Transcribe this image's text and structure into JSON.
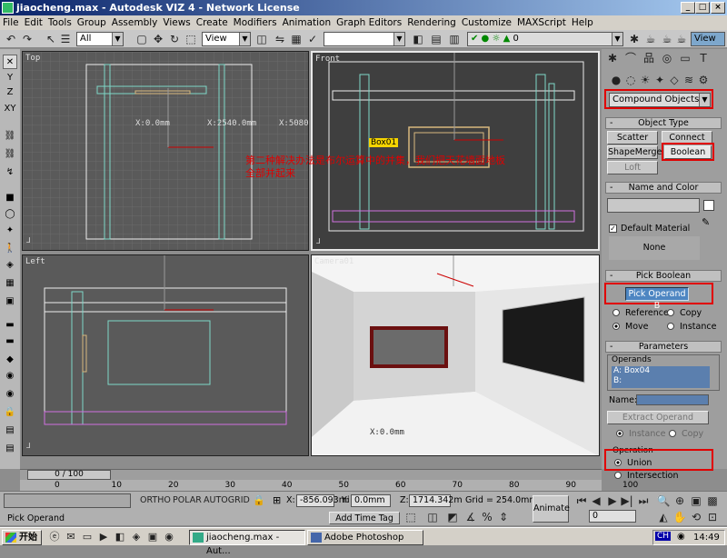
{
  "window": {
    "title": "jiaocheng.max - Autodesk VIZ 4 - Network License"
  },
  "menu": [
    "File",
    "Edit",
    "Tools",
    "Group",
    "Assembly",
    "Views",
    "Create",
    "Modifiers",
    "Animation",
    "Graph Editors",
    "Rendering",
    "Customize",
    "MAXScript",
    "Help"
  ],
  "toolbar": {
    "selection_filter": "All",
    "ref_coord": "View",
    "named_selection": "",
    "layer": "0",
    "view_right": "View"
  },
  "viewports": {
    "top": {
      "label": "Top",
      "coord_x": "X:0.0mm",
      "coord_x2": "X:2540.0mm",
      "coord_x3": "X:5080"
    },
    "front": {
      "label": "Front",
      "object_tag": "Box01",
      "annotation_line1": "第二种解决办法是布尔运算中的并集，我们把天花墙面地板",
      "annotation_line2": "全部并起来"
    },
    "left": {
      "label": "Left"
    },
    "camera": {
      "label": "Camera01",
      "coord": "X:0.0mm"
    }
  },
  "command_panel": {
    "category": "Compound Objects",
    "object_type": {
      "header": "Object Type",
      "buttons": [
        "Scatter",
        "Connect",
        "ShapeMerge",
        "Boolean",
        "Loft"
      ]
    },
    "name_color": {
      "header": "Name and Color",
      "name_value": ""
    },
    "default_material": "Default Material",
    "material_value": "None",
    "pick_boolean": {
      "header": "Pick Boolean",
      "button": "Pick Operand B",
      "options": [
        "Reference",
        "Copy",
        "Move",
        "Instance"
      ],
      "selected": "Move"
    },
    "parameters": {
      "header": "Parameters",
      "operands_label": "Operands",
      "operands": [
        "A: Box04",
        "B:"
      ],
      "name_label": "Name:",
      "extract_button": "Extract Operand",
      "extract_options": [
        "Instance",
        "Copy"
      ],
      "operation_label": "Operation",
      "operation_options": [
        "Union",
        "Intersection"
      ],
      "operation_selected": "Union"
    }
  },
  "timeline": {
    "frame": "0 / 100",
    "ticks": [
      "0",
      "10",
      "20",
      "30",
      "40",
      "50",
      "60",
      "70",
      "80",
      "90",
      "100"
    ]
  },
  "status": {
    "prompt": "Pick Operand",
    "snap_labels": [
      "ORTHO",
      "POLAR",
      "AUTOGRID"
    ],
    "x_label": "X:",
    "x_value": "-856.093mi",
    "y_label": "Y:",
    "y_value": "0.0mm",
    "z_label": "Z:",
    "z_value": "1714.342m",
    "grid": "Grid = 254.0mm",
    "add_time_tag": "Add Time Tag",
    "animate": "Animate",
    "frame_value": "0"
  },
  "taskbar": {
    "start": "开始",
    "tasks": [
      "jiaocheng.max - Aut...",
      "Adobe Photoshop"
    ],
    "ime": "CH",
    "clock": "14:49"
  },
  "colors": {
    "viewport_bg": "#5a5a5a",
    "active_viewport_bg": "#3f3f3f",
    "highlight_red": "#e00000",
    "object_cyan": "#7fd8c8"
  }
}
